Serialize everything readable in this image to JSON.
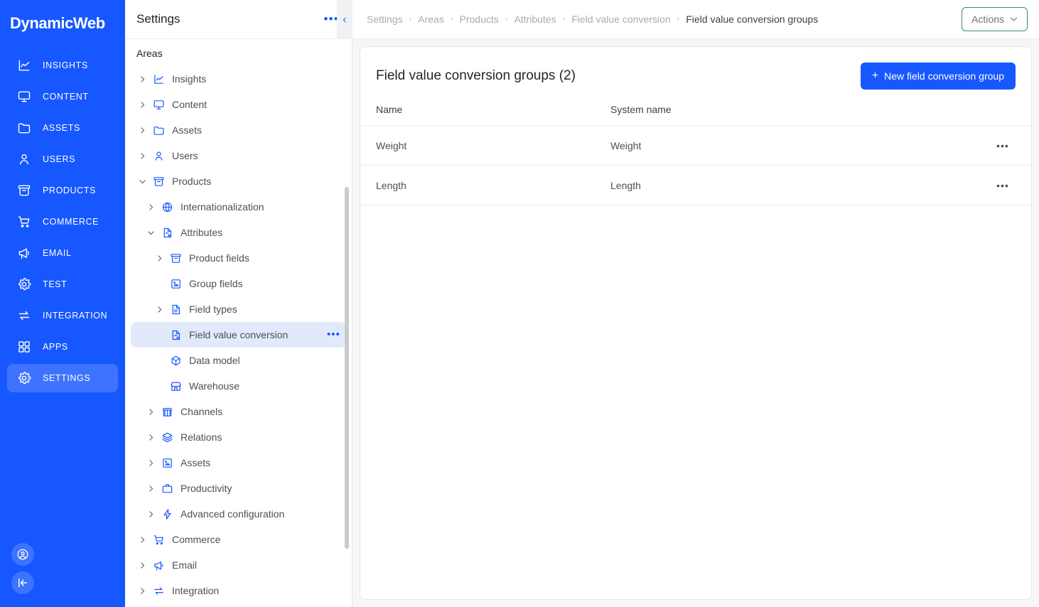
{
  "brand": {
    "name": "DynamicWeb"
  },
  "rail": {
    "items": [
      {
        "label": "INSIGHTS",
        "icon": "chart-line-icon",
        "active": false
      },
      {
        "label": "CONTENT",
        "icon": "monitor-icon",
        "active": false
      },
      {
        "label": "ASSETS",
        "icon": "folder-icon",
        "active": false
      },
      {
        "label": "USERS",
        "icon": "user-icon",
        "active": false
      },
      {
        "label": "PRODUCTS",
        "icon": "archive-box-icon",
        "active": false
      },
      {
        "label": "COMMERCE",
        "icon": "cart-icon",
        "active": false
      },
      {
        "label": "EMAIL",
        "icon": "megaphone-icon",
        "active": false
      },
      {
        "label": "TEST",
        "icon": "gear-icon",
        "active": false
      },
      {
        "label": "INTEGRATION",
        "icon": "transfer-icon",
        "active": false
      },
      {
        "label": "APPS",
        "icon": "grid-icon",
        "active": false
      },
      {
        "label": "SETTINGS",
        "icon": "gear-icon",
        "active": true
      }
    ],
    "bottom": [
      {
        "icon": "account-circle-icon"
      },
      {
        "icon": "collapse-left-icon"
      }
    ]
  },
  "tree": {
    "title": "Settings",
    "more_label": "•••",
    "section_label": "Areas",
    "collapse_icon": "chevron-left-icon",
    "nodes": [
      {
        "label": "Internationalization",
        "icon": "globe-icon",
        "depth": 1,
        "twisty": "collapsed",
        "selected": false
      },
      {
        "label": "Attributes",
        "icon": "document-add-icon",
        "depth": 1,
        "twisty": "expanded",
        "selected": false
      },
      {
        "label": "Product fields",
        "icon": "archive-box-icon",
        "depth": 2,
        "twisty": "collapsed",
        "selected": false
      },
      {
        "label": "Group fields",
        "icon": "image-frame-icon",
        "depth": 2,
        "twisty": "none",
        "selected": false
      },
      {
        "label": "Field types",
        "icon": "document-icon",
        "depth": 2,
        "twisty": "collapsed",
        "selected": false
      },
      {
        "label": "Field value conversion",
        "icon": "document-add-icon",
        "depth": 2,
        "twisty": "none",
        "selected": true
      },
      {
        "label": "Data model",
        "icon": "cube-icon",
        "depth": 2,
        "twisty": "none",
        "selected": false
      },
      {
        "label": "Warehouse",
        "icon": "storefront-icon",
        "depth": 2,
        "twisty": "none",
        "selected": false
      },
      {
        "label": "Channels",
        "icon": "store-icon",
        "depth": 1,
        "twisty": "collapsed",
        "selected": false
      },
      {
        "label": "Relations",
        "icon": "layers-icon",
        "depth": 1,
        "twisty": "collapsed",
        "selected": false
      },
      {
        "label": "Assets",
        "icon": "image-frame-icon",
        "depth": 1,
        "twisty": "collapsed",
        "selected": false
      },
      {
        "label": "Productivity",
        "icon": "briefcase-icon",
        "depth": 1,
        "twisty": "collapsed",
        "selected": false
      },
      {
        "label": "Advanced configuration",
        "icon": "bolt-icon",
        "depth": 1,
        "twisty": "collapsed",
        "selected": false
      },
      {
        "label": "Commerce",
        "icon": "cart-icon",
        "depth": 0,
        "twisty": "collapsed",
        "selected": false
      },
      {
        "label": "Email",
        "icon": "megaphone-icon",
        "depth": 0,
        "twisty": "collapsed",
        "selected": false
      },
      {
        "label": "Integration",
        "icon": "transfer-icon",
        "depth": 0,
        "twisty": "collapsed",
        "selected": false
      }
    ],
    "top_nodes": [
      {
        "label": "Insights",
        "icon": "chart-line-icon",
        "depth": 0,
        "twisty": "collapsed",
        "selected": false
      },
      {
        "label": "Content",
        "icon": "monitor-icon",
        "depth": 0,
        "twisty": "collapsed",
        "selected": false
      },
      {
        "label": "Assets",
        "icon": "folder-icon",
        "depth": 0,
        "twisty": "collapsed",
        "selected": false
      },
      {
        "label": "Users",
        "icon": "user-icon",
        "depth": 0,
        "twisty": "collapsed",
        "selected": false
      },
      {
        "label": "Products",
        "icon": "archive-box-icon",
        "depth": 0,
        "twisty": "expanded",
        "selected": false
      }
    ]
  },
  "breadcrumb": {
    "separator": "›",
    "items": [
      "Settings",
      "Areas",
      "Products",
      "Attributes",
      "Field value conversion",
      "Field value conversion groups"
    ]
  },
  "actions_button": {
    "label": "Actions",
    "icon": "chevron-down-icon"
  },
  "card": {
    "title": "Field value conversion groups (2)",
    "new_button": {
      "label": "New field conversion group",
      "icon": "plus-icon"
    },
    "columns": [
      "Name",
      "System name"
    ],
    "row_menu_label": "•••",
    "rows": [
      {
        "name": "Weight",
        "system_name": "Weight"
      },
      {
        "name": "Length",
        "system_name": "Length"
      }
    ]
  },
  "colors": {
    "brand_blue": "#1757ff",
    "rail_active": "#3d73ff",
    "tree_selected": "#e2e9fa",
    "actions_border_green": "#3f8f63",
    "text_dark": "#22252c",
    "text_muted": "#a9abb0",
    "page_bg": "#f6f6f7"
  }
}
